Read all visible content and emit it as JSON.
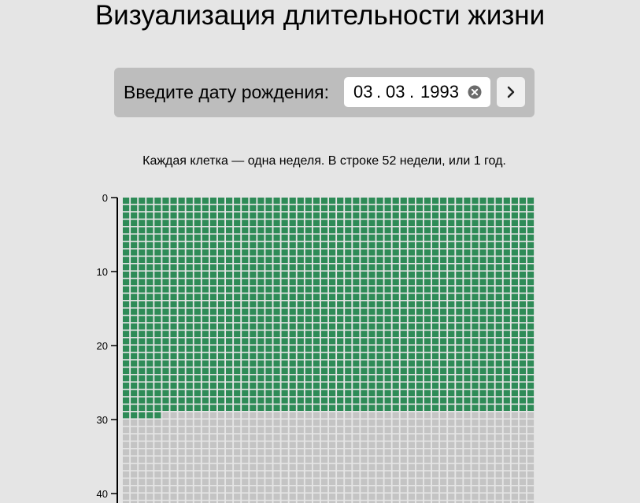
{
  "title": "Визуализация длительности жизни",
  "form": {
    "label": "Введите дату рождения:",
    "day": "03",
    "month": "03",
    "year": "1993",
    "separator": ".",
    "clear_icon": "clear-circle-x-icon",
    "submit_icon": "chevron-right-icon"
  },
  "caption": "Каждая клетка — одна неделя. В строке 52 недели, или 1 год.",
  "chart_data": {
    "type": "heatmap",
    "weeks_per_row": 52,
    "y_ticks": [
      0,
      10,
      20,
      30,
      40
    ],
    "lived_full_years": 29,
    "lived_extra_weeks": 5,
    "visible_rows": 42,
    "colors": {
      "lived": "#2e8b57",
      "remaining": "#c4c4c4",
      "axis": "#000000"
    }
  }
}
